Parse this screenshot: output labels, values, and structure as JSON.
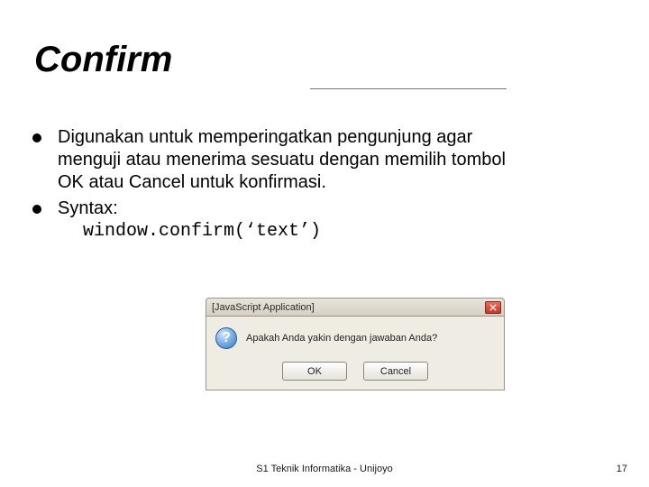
{
  "title": "Confirm",
  "bullets": [
    {
      "text": "Digunakan untuk memperingatkan pengunjung agar menguji atau menerima sesuatu dengan memilih tombol OK atau Cancel untuk konfirmasi."
    },
    {
      "text": "Syntax:",
      "code": "window.confirm(‘text’)"
    }
  ],
  "dialog": {
    "title": "[JavaScript Application]",
    "message": "Apakah Anda yakin dengan jawaban Anda?",
    "ok_label": "OK",
    "cancel_label": "Cancel",
    "question_mark": "?"
  },
  "footer": "S1 Teknik Informatika - Unijoyo",
  "page_number": "17"
}
